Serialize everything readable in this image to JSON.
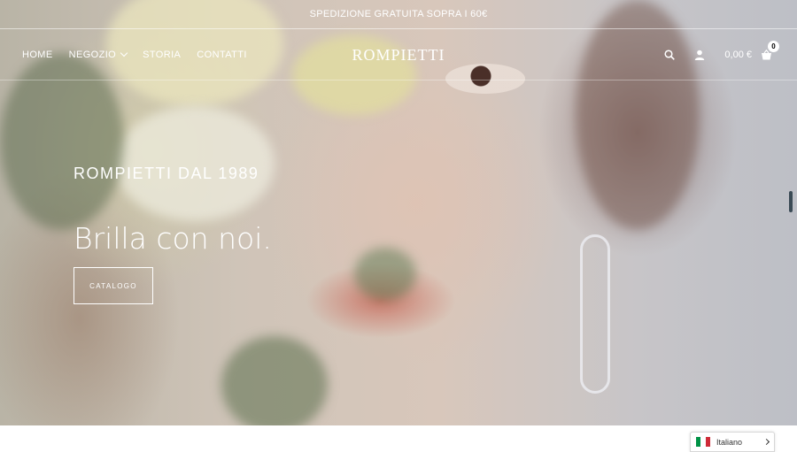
{
  "promo": {
    "text": "SPEDIZIONE GRATUITA SOPRA I 60€"
  },
  "nav": {
    "items": [
      {
        "label": "HOME"
      },
      {
        "label": "NEGOZIO",
        "has_dropdown": true
      },
      {
        "label": "STORIA"
      },
      {
        "label": "CONTATTI"
      }
    ]
  },
  "brand": {
    "logo": "ROMPIETTI"
  },
  "header_tools": {
    "search_icon": "search-icon",
    "account_icon": "user-icon",
    "cart_icon": "basket-icon",
    "cart_total": "0,00 €",
    "cart_count": "0"
  },
  "hero": {
    "subtitle": "ROMPIETTI DAL 1989",
    "title": "Brilla con noi.",
    "cta_label": "CATALOGO"
  },
  "language": {
    "selected": "Italiano",
    "flag_colors": [
      "#009246",
      "#ffffff",
      "#ce2b37"
    ]
  },
  "colors": {
    "text_on_hero": "#ffffff",
    "scrollbar": "#3a4a55"
  }
}
